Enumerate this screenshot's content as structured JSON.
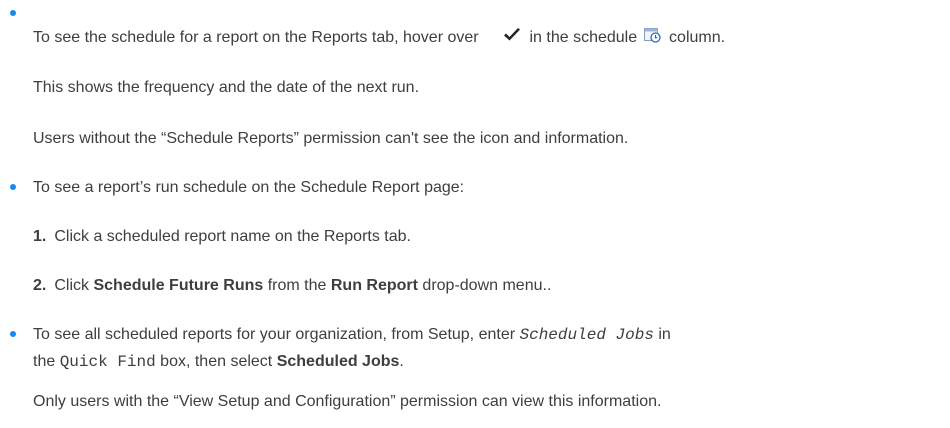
{
  "bullet1": {
    "text_before": "To see the schedule for a report on the Reports tab, hover over",
    "check_icon": "checkmark-icon",
    "text_middle": "in the schedule",
    "schedule_icon": "schedule-calendar-clock-icon",
    "text_after": "column.",
    "para2": "This shows the frequency and the date of the next run.",
    "para3": "Users without the “Schedule Reports” permission can't see the icon and information."
  },
  "bullet2": {
    "text": "To see a report’s run schedule on the Schedule Report page:",
    "steps": [
      {
        "number": "1.",
        "text": "Click a scheduled report name on the Reports tab."
      },
      {
        "number": "2.",
        "pre": "Click",
        "strong1": "Schedule Future Runs",
        "mid": "from the",
        "strong2": "Run Report",
        "post": "drop-down menu.."
      }
    ]
  },
  "bullet3": {
    "pre": "To see all scheduled reports for your organization, from Setup, enter",
    "code1": "Scheduled Jobs",
    "mid": "in",
    "line2_pre": "the",
    "code2": "Quick Find",
    "line2_mid": "box, then select",
    "strong": "Scheduled Jobs",
    "line2_post": ".",
    "para2": "Only users with the “View Setup and Configuration” permission can view this information."
  },
  "colors": {
    "text": "#3e3e3c",
    "bullet": "#1589ee"
  }
}
